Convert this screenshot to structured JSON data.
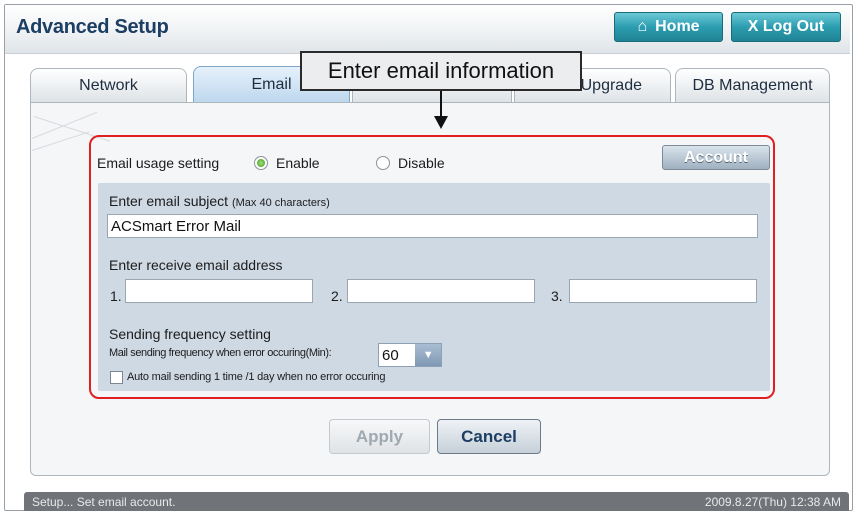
{
  "header": {
    "title": "Advanced Setup",
    "home_label": "Home",
    "logout_label": "X Log Out",
    "home_icon": "home-icon"
  },
  "tabs": [
    {
      "label": "Network",
      "active": false
    },
    {
      "label": "Email",
      "active": true
    },
    {
      "label": "",
      "active": false
    },
    {
      "label": "Upgrade",
      "active": false
    },
    {
      "label": "DB Management",
      "active": false
    }
  ],
  "callout": {
    "text": "Enter email information"
  },
  "email": {
    "usage_label": "Email usage setting",
    "enable_label": "Enable",
    "disable_label": "Disable",
    "enabled": true,
    "account_label": "Account",
    "subject_label": "Enter email subject",
    "subject_hint": "(Max 40 characters)",
    "subject_value": "ACSmart Error Mail",
    "receive_label": "Enter receive email address",
    "addresses": [
      {
        "num": "1.",
        "value": ""
      },
      {
        "num": "2.",
        "value": ""
      },
      {
        "num": "3.",
        "value": ""
      }
    ],
    "frequency_label": "Sending frequency setting",
    "frequency_desc": "Mail sending frequency when error occuring(Min):",
    "frequency_value": "60",
    "auto_label": "Auto mail sending 1 time /1 day when no error occuring",
    "auto_checked": false
  },
  "buttons": {
    "apply": "Apply",
    "cancel": "Cancel"
  },
  "status": {
    "message": "Setup... Set email account.",
    "datetime": "2009.8.27(Thu)  12:38 AM"
  },
  "colors": {
    "highlight": "#e02020",
    "header_button": "#2c9db0",
    "title": "#1d3e63"
  }
}
